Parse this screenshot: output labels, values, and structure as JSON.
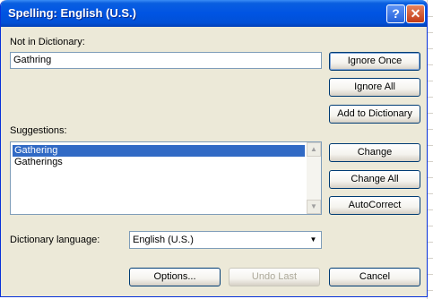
{
  "window": {
    "title": "Spelling: English (U.S.)",
    "help_glyph": "?",
    "close_glyph": "✕"
  },
  "not_in_dictionary": {
    "label": "Not in Dictionary:",
    "value": "Gathring"
  },
  "suggestions": {
    "label": "Suggestions:",
    "items": [
      "Gathering",
      "Gatherings"
    ],
    "selected": "Gathering"
  },
  "dictionary_language": {
    "label": "Dictionary language:",
    "value": "English (U.S.)"
  },
  "buttons": {
    "ignore_once": "Ignore Once",
    "ignore_all": "Ignore All",
    "add_to_dictionary": "Add to Dictionary",
    "change": "Change",
    "change_all": "Change All",
    "autocorrect": "AutoCorrect",
    "options": "Options...",
    "undo_last": "Undo Last",
    "cancel": "Cancel"
  },
  "colors": {
    "title_bar": "#0054e3",
    "selection": "#316ac5",
    "dialog_face": "#ece9d8",
    "close_button": "#c23b17"
  }
}
